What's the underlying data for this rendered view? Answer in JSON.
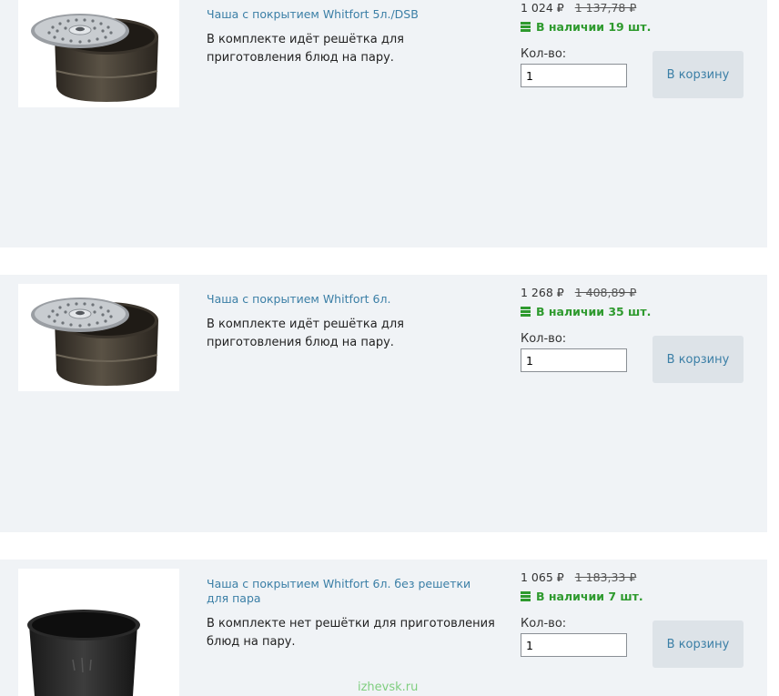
{
  "products": [
    {
      "title": "Чаша с покрытием Whitfort 5л./DSB",
      "description": "В комплекте идёт решётка для приготовления блюд на пару.",
      "price": "1 024 ₽",
      "old_price": "1 137,78 ₽",
      "stock": "В наличии 19 шт.",
      "qty_label": "Кол-во:",
      "qty_value": "1",
      "cart_label": "В корзину",
      "image": "bowl-with-steamer-rack"
    },
    {
      "title": "Чаша с покрытием Whitfort 6л.",
      "description": "В комплекте идёт решётка для приготовления блюд на пару.",
      "price": "1 268 ₽",
      "old_price": "1 408,89 ₽",
      "stock": "В наличии 35 шт.",
      "qty_label": "Кол-во:",
      "qty_value": "1",
      "cart_label": "В корзину",
      "image": "bowl-with-steamer-rack"
    },
    {
      "title": "Чаша с покрытием Whitfort 6л. без решетки для пара",
      "description": "В комплекте нет решётки для приготовления блюд на пару.",
      "price": "1 065 ₽",
      "old_price": "1 183,33 ₽",
      "stock": "В наличии 7 шт.",
      "qty_label": "Кол-во:",
      "qty_value": "1",
      "cart_label": "В корзину",
      "image": "bowl-without-rack"
    }
  ],
  "watermark": "izhevsk.ru",
  "colors": {
    "card_bg": "#f0f3f6",
    "link": "#3b7fa6",
    "in_stock": "#2e9a2e",
    "button_bg": "#dde3e8"
  }
}
